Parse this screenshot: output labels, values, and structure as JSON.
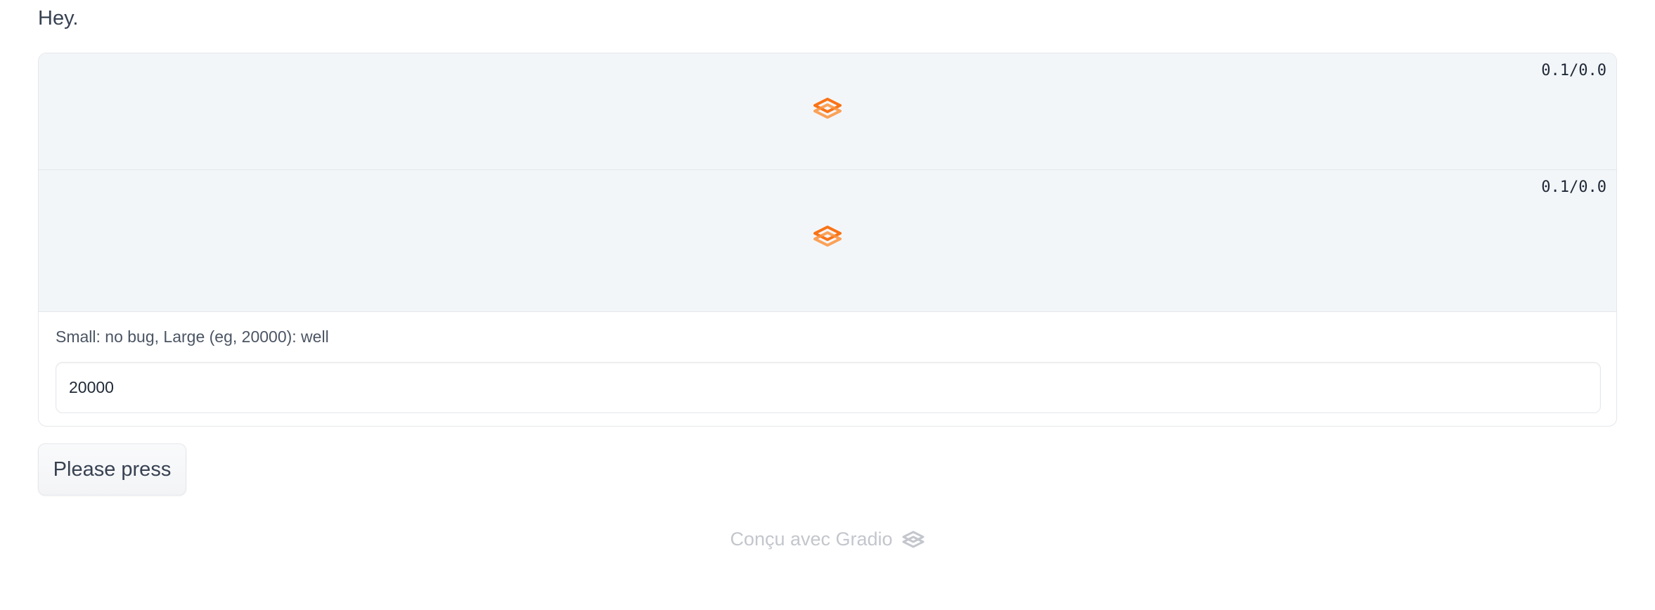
{
  "intro_text": "Hey.",
  "outputs": [
    {
      "progress": "0.1/0.0",
      "icon": "gradio-loader-icon"
    },
    {
      "progress": "0.1/0.0",
      "icon": "gradio-loader-icon"
    }
  ],
  "input": {
    "label": "Small: no bug, Large (eg, 20000): well",
    "value": "20000"
  },
  "button": {
    "label": "Please press"
  },
  "footer": {
    "text": "Conçu avec Gradio",
    "icon": "gradio-logo-icon"
  },
  "colors": {
    "accent": "#f97316",
    "panel_bg": "#f3f6f9"
  }
}
